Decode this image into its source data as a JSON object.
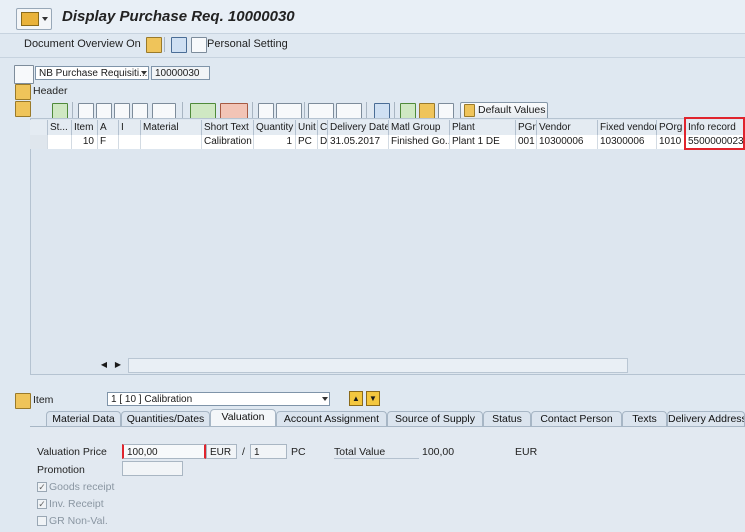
{
  "window": {
    "title": "Display Purchase Req. 10000030"
  },
  "toolbar": {
    "document_overview": "Document Overview On",
    "personal_setting": "Personal Setting"
  },
  "header_area": {
    "doc_type": "NB Purchase Requisiti...",
    "doc_number": "10000030",
    "header_label": "Header"
  },
  "grid_toolbar": {
    "default_values": "Default Values"
  },
  "grid": {
    "columns": [
      "St...",
      "Item",
      "A",
      "I",
      "Material",
      "Short Text",
      "Quantity",
      "Unit",
      "C",
      "Delivery Date",
      "Matl Group",
      "Plant",
      "PGr",
      "Vendor",
      "Fixed vendor",
      "POrg",
      "Info record"
    ],
    "rows": [
      {
        "status": "",
        "item": "10",
        "acct": "F",
        "i": "",
        "material": "",
        "short_text": "Calibration",
        "quantity": "1",
        "unit": "PC",
        "c": "D",
        "delivery_date": "31.05.2017",
        "matl_group": "Finished Go...",
        "plant": "Plant 1 DE",
        "pgr": "001",
        "vendor": "10300006",
        "fixed_vendor": "10300006",
        "porg": "1010",
        "info_record": "5500000023"
      }
    ]
  },
  "item_area": {
    "label": "Item",
    "selected": "1 [ 10 ] Calibration"
  },
  "tabs": [
    "Material Data",
    "Quantities/Dates",
    "Valuation",
    "Account Assignment",
    "Source of Supply",
    "Status",
    "Contact Person",
    "Texts",
    "Delivery Address"
  ],
  "valuation": {
    "price_label": "Valuation Price",
    "price_value": "100,00",
    "currency": "EUR",
    "slash": "/",
    "per_qty": "1",
    "per_unit": "PC",
    "total_label": "Total Value",
    "total_value": "100,00",
    "total_currency": "EUR",
    "promotion_label": "Promotion",
    "goods_receipt": "Goods receipt",
    "inv_receipt": "Inv. Receipt",
    "gr_non_val": "GR Non-Val.",
    "check_mark": "✓"
  },
  "colors": {
    "highlight": "#e0242d",
    "panel": "#dfe8f1"
  }
}
